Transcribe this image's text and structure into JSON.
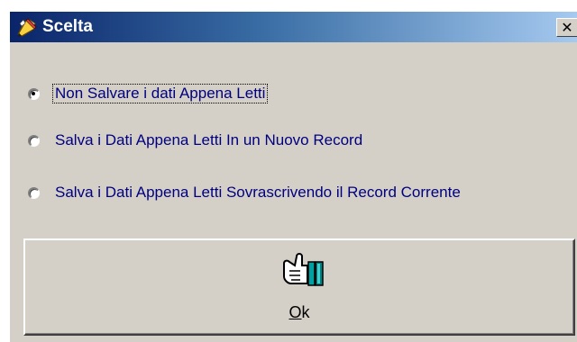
{
  "window": {
    "title": "Scelta",
    "close_glyph": "✕",
    "app_icon": "edit-pencil-icon"
  },
  "options": [
    {
      "label": "Non Salvare i dati Appena Letti",
      "checked": true
    },
    {
      "label": "Salva i Dati Appena Letti In un Nuovo Record",
      "checked": false
    },
    {
      "label": "Salva i Dati Appena Letti Sovrascrivendo il Record Corrente",
      "checked": false
    }
  ],
  "ok_button": {
    "mnemonic": "O",
    "label_rest": "k",
    "icon": "thumbs-up-icon"
  },
  "colors": {
    "title_gradient_start": "#0a246a",
    "title_gradient_end": "#a6caf0",
    "dialog_face": "#d4d0c8",
    "option_text": "#000080"
  }
}
